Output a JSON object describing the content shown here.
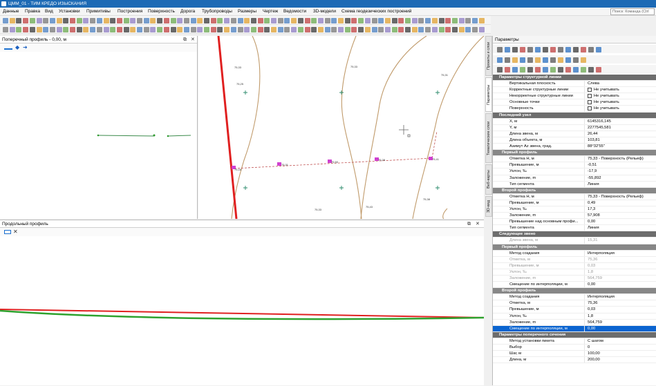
{
  "app": {
    "title": "ЦММ_01 - ТИМ КРЕДО ИЗЫСКАНИЯ"
  },
  "menu": {
    "items": [
      "Данные",
      "Правка",
      "Вид",
      "Установки",
      "Примитивы",
      "Построения",
      "Поверхность",
      "Дорога",
      "Трубопроводы",
      "Размеры",
      "Чертеж",
      "Ведомости",
      "3D-модели",
      "Схема геодезических построений"
    ],
    "search_placeholder": "Поиск: Команда (Ctrl"
  },
  "cross_profile": {
    "title": "Поперечный профиль - 0,00, м"
  },
  "long_profile": {
    "title": "Продольный профиль"
  },
  "params_panel": {
    "title": "Параметры"
  },
  "side_tabs": [
    "Проекты и слои",
    "Параметры",
    "Тематические слои",
    "Веб-карты",
    "3D-вид"
  ],
  "plan_labels": {
    "l1": "75,33",
    "l2": "75,25",
    "l3": "75,33",
    "l4": "75,31",
    "l5": "75,44",
    "l6": "75,31",
    "l7": "75,50",
    "l8": "75,28",
    "l9": "75,41",
    "l10": "75,33",
    "l11": "75,43",
    "l12": "75,38"
  },
  "params": [
    {
      "type": "sec",
      "k": "Параметры структурной линии"
    },
    {
      "k": "Вертикальная плоскость",
      "v": "Слева"
    },
    {
      "k": "Корректные структурные линии",
      "v": "Не учитывать",
      "cb": true
    },
    {
      "k": "Некорректные структурные линии",
      "v": "Не учитывать",
      "cb": true
    },
    {
      "k": "Основные точки",
      "v": "Не учитывать",
      "cb": true
    },
    {
      "k": "Поверхность",
      "v": "Не учитывать",
      "cb": true
    },
    {
      "type": "sec",
      "k": "Последний узел"
    },
    {
      "k": "X, м",
      "v": "6145316,145"
    },
    {
      "k": "Y, м",
      "v": "2277545,581"
    },
    {
      "k": "Длина звена, м",
      "v": "26,44"
    },
    {
      "k": "Длина объекта, м",
      "v": "103,81"
    },
    {
      "k": "Азимут Az звена, град.",
      "v": "88°32'55\""
    },
    {
      "type": "sub",
      "k": "Первый профиль"
    },
    {
      "k": "Отметка Н, м",
      "v": "75,33 - Поверхность (Рельеф)"
    },
    {
      "k": "Превышение, м",
      "v": "-0,51"
    },
    {
      "k": "Уклон, ‰",
      "v": "-17,9"
    },
    {
      "k": "Заложение, m",
      "v": "-55,892"
    },
    {
      "k": "Тип сегмента",
      "v": "Линия"
    },
    {
      "type": "sub",
      "k": "Второй профиль"
    },
    {
      "k": "Отметка Н, м",
      "v": "75,33 - Поверхность (Рельеф)"
    },
    {
      "k": "Превышение, м",
      "v": "0,49"
    },
    {
      "k": "Уклон, ‰",
      "v": "17,3"
    },
    {
      "k": "Заложение, m",
      "v": "57,908"
    },
    {
      "k": "Превышение над основным профи...",
      "v": "0,00"
    },
    {
      "k": "Тип сегмента",
      "v": "Линия"
    },
    {
      "type": "sec",
      "k": "Следующее звено"
    },
    {
      "k": "Длина звена, м",
      "v": "15,31",
      "dim": true
    },
    {
      "type": "sub",
      "k": "Первый профиль"
    },
    {
      "k": "Метод создания",
      "v": "Интерполяция"
    },
    {
      "k": "Отметка, м",
      "v": "75,36",
      "dim": true
    },
    {
      "k": "Превышение, м",
      "v": "0,03",
      "dim": true
    },
    {
      "k": "Уклон, ‰",
      "v": "1,8",
      "dim": true
    },
    {
      "k": "Заложение, m",
      "v": "564,759",
      "dim": true
    },
    {
      "k": "Смещение по интерполяции, м",
      "v": "0,00"
    },
    {
      "type": "sub",
      "k": "Второй профиль"
    },
    {
      "k": "Метод создания",
      "v": "Интерполяция"
    },
    {
      "k": "Отметка, м",
      "v": "75,36"
    },
    {
      "k": "Превышение, м",
      "v": "0,03"
    },
    {
      "k": "Уклон, ‰",
      "v": "1,8"
    },
    {
      "k": "Заложение, m",
      "v": "564,759"
    },
    {
      "k": "Смещение по интерполяции, м",
      "v": "0,00",
      "sel": true
    },
    {
      "type": "sec",
      "k": "Параметры поперечного сечения"
    },
    {
      "k": "Метод установки пикета",
      "v": "С шагом"
    },
    {
      "k": "Выбор",
      "v": "0"
    },
    {
      "k": "Шаг, м",
      "v": "100,00"
    },
    {
      "k": "Длина, м",
      "v": "200,00"
    }
  ],
  "colors": {
    "title_bar": "#1d6ab5",
    "red_line": "#e02020",
    "green_line": "#2ea22e",
    "contour": "#c09a6a",
    "selection": "#0a64d0"
  }
}
